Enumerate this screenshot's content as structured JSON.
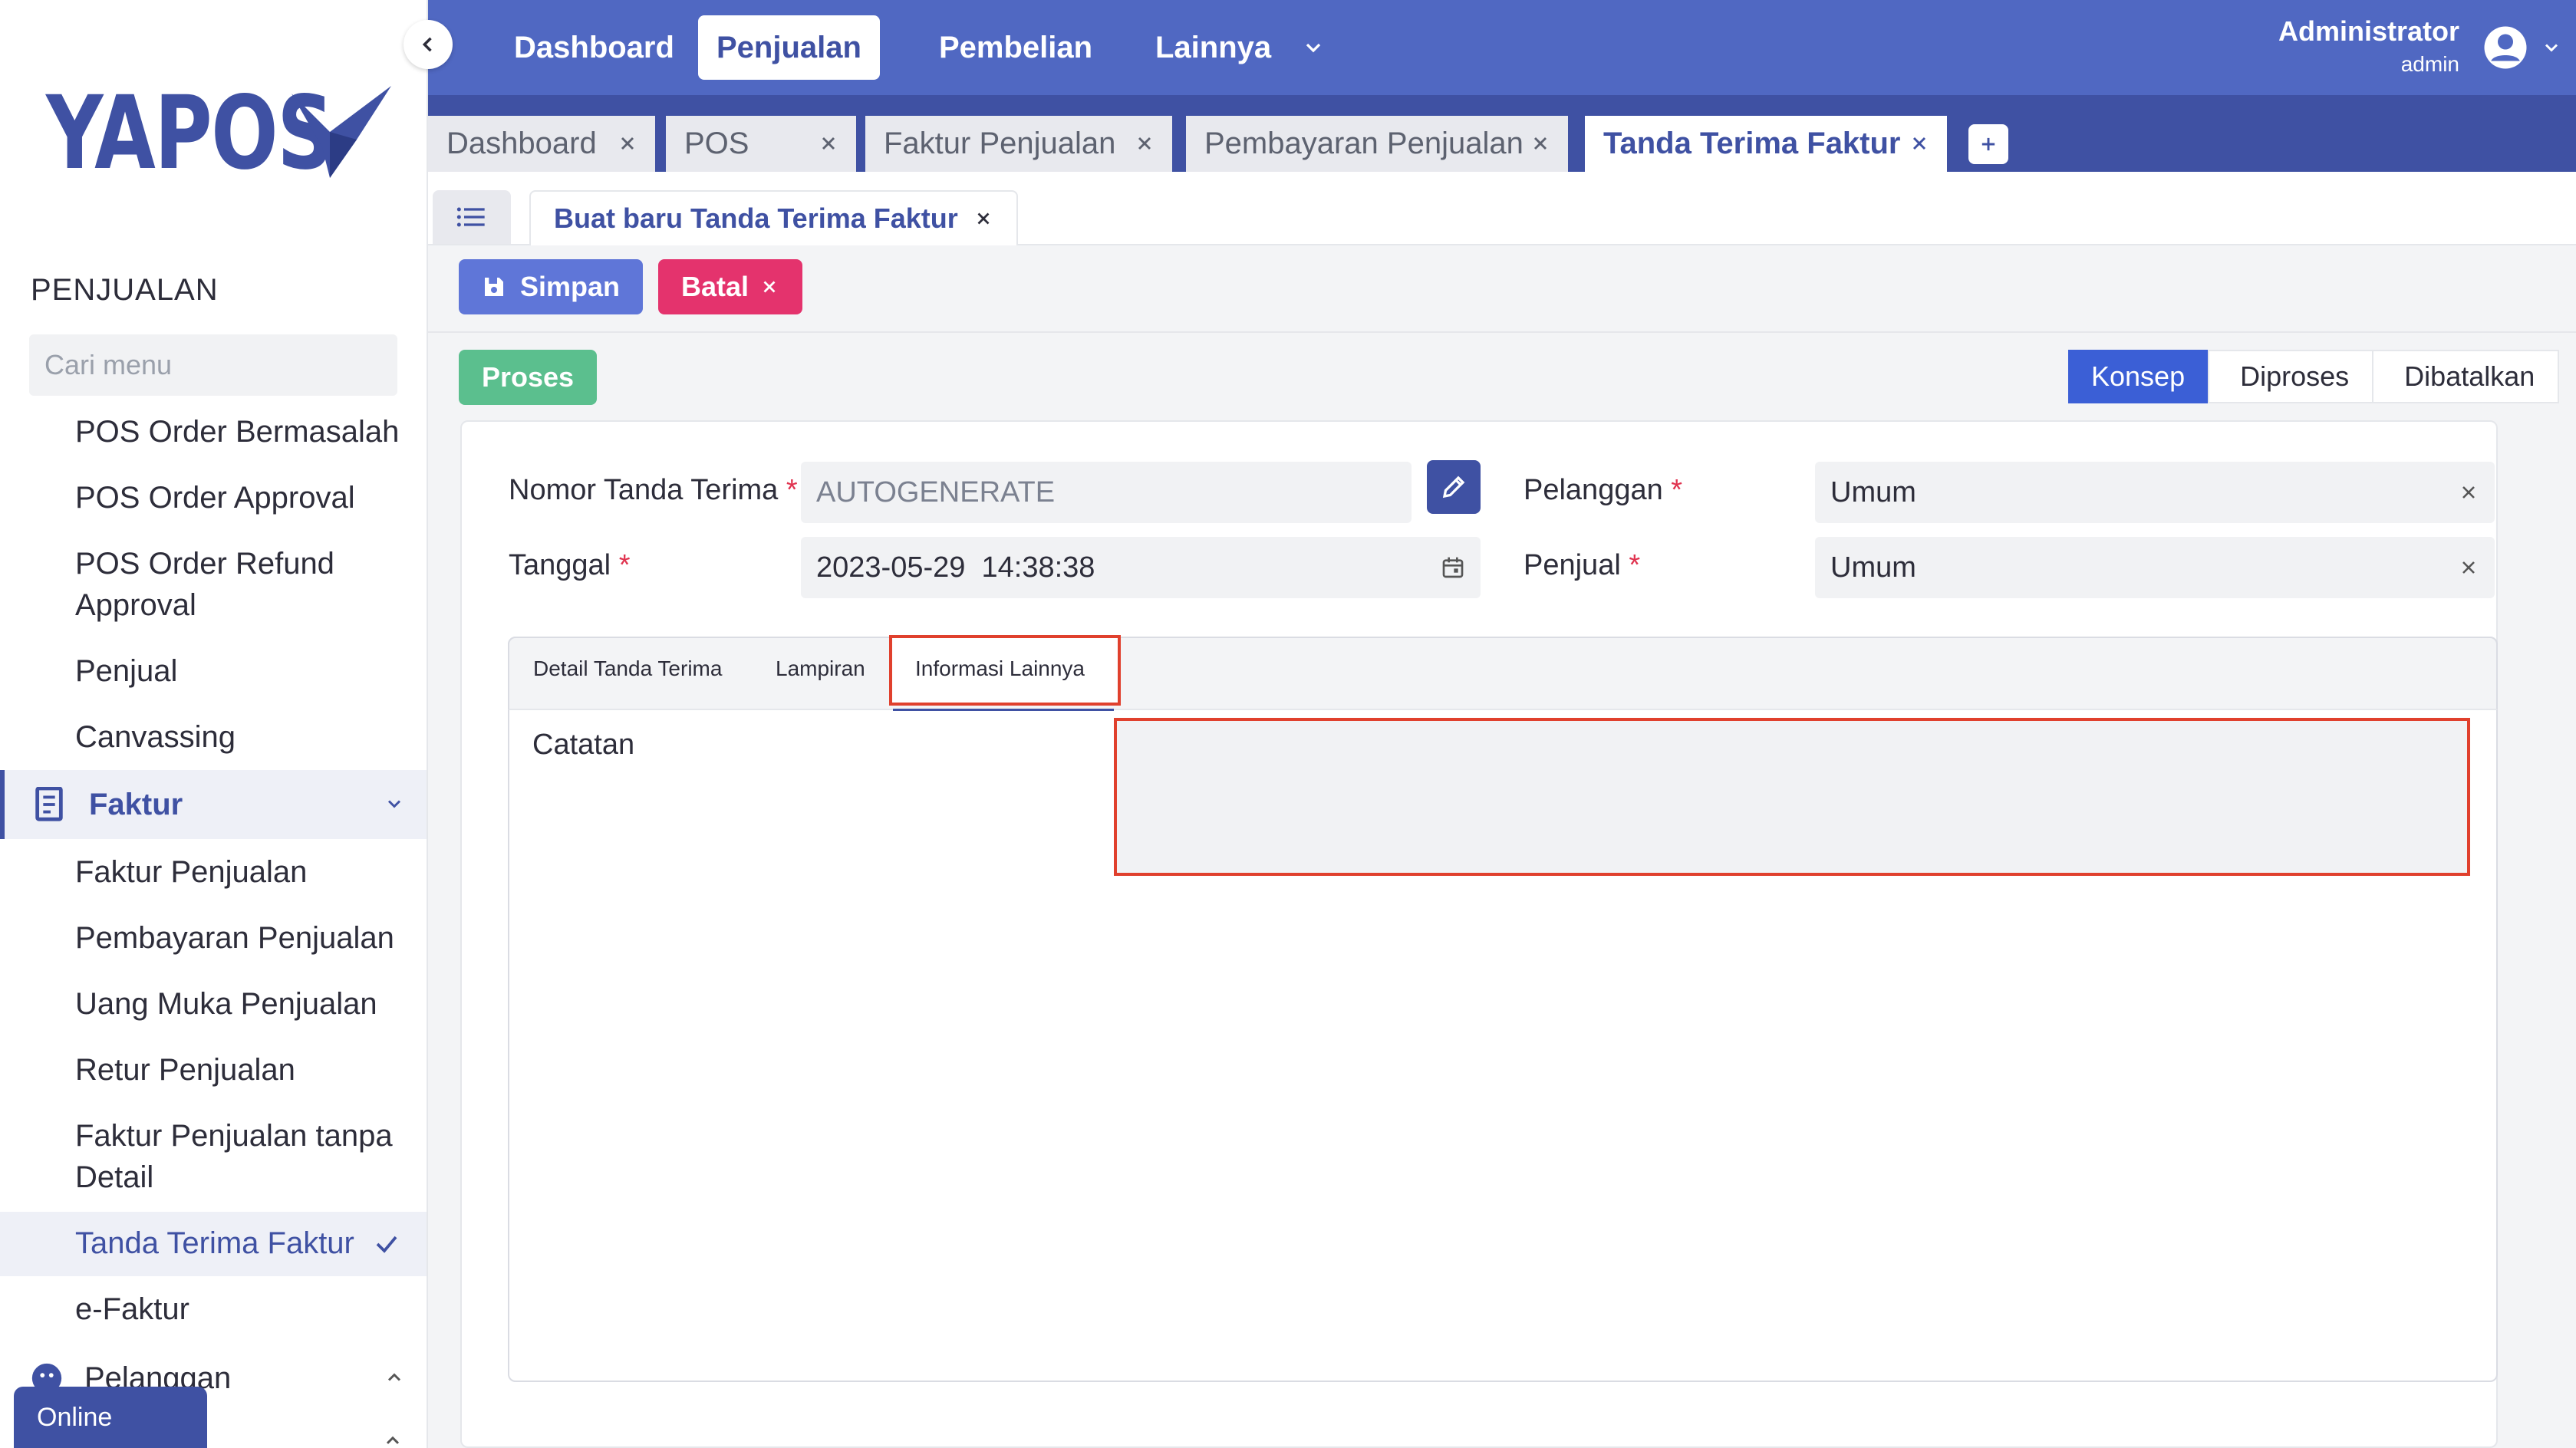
{
  "brand": {
    "name": "YAPOS",
    "color": "#3f51a3"
  },
  "sidebar": {
    "section": "PENJUALAN",
    "search_placeholder": "Cari menu",
    "items_top": [
      {
        "label": "POS Order Bermasalah"
      },
      {
        "label": "POS Order Approval"
      },
      {
        "label": "POS Order Refund Approval"
      },
      {
        "label": "Penjual"
      },
      {
        "label": "Canvassing"
      }
    ],
    "group_faktur": "Faktur",
    "items_faktur": [
      {
        "label": "Faktur Penjualan"
      },
      {
        "label": "Pembayaran Penjualan"
      },
      {
        "label": "Uang Muka Penjualan"
      },
      {
        "label": "Retur Penjualan"
      },
      {
        "label": "Faktur Penjualan tanpa Detail"
      },
      {
        "label": "Tanda Terima Faktur"
      },
      {
        "label": "e-Faktur"
      }
    ],
    "group_pelanggan": "Pelanggan",
    "online": "Online"
  },
  "topnav": {
    "items": [
      "Dashboard",
      "Penjualan",
      "Pembelian",
      "Lainnya"
    ],
    "active": "Penjualan",
    "user_name": "Administrator",
    "user_role": "admin"
  },
  "tabs": [
    "Dashboard",
    "POS",
    "Faktur Penjualan",
    "Pembayaran Penjualan",
    "Tanda Terima Faktur"
  ],
  "subtab": "Buat baru Tanda Terima Faktur",
  "actions": {
    "save": "Simpan",
    "cancel": "Batal",
    "process": "Proses"
  },
  "status_steps": [
    "Konsep",
    "Diproses",
    "Dibatalkan"
  ],
  "form": {
    "nomor_label": "Nomor Tanda Terima",
    "nomor_value": "AUTOGENERATE",
    "tanggal_label": "Tanggal",
    "tanggal_value": "2023-05-29  14:38:38",
    "pelanggan_label": "Pelanggan",
    "pelanggan_value": "Umum",
    "penjual_label": "Penjual",
    "penjual_value": "Umum"
  },
  "panel_tabs": [
    "Detail Tanda Terima",
    "Lampiran",
    "Informasi Lainnya"
  ],
  "catatan_label": "Catatan",
  "colors": {
    "topbar": "#5068c2",
    "tabstrip": "#3f51a3",
    "save": "#5f76d8",
    "cancel": "#e4336d",
    "process": "#5bbf8e",
    "status_active": "#3b5fd6",
    "highlight": "#e0402d"
  }
}
